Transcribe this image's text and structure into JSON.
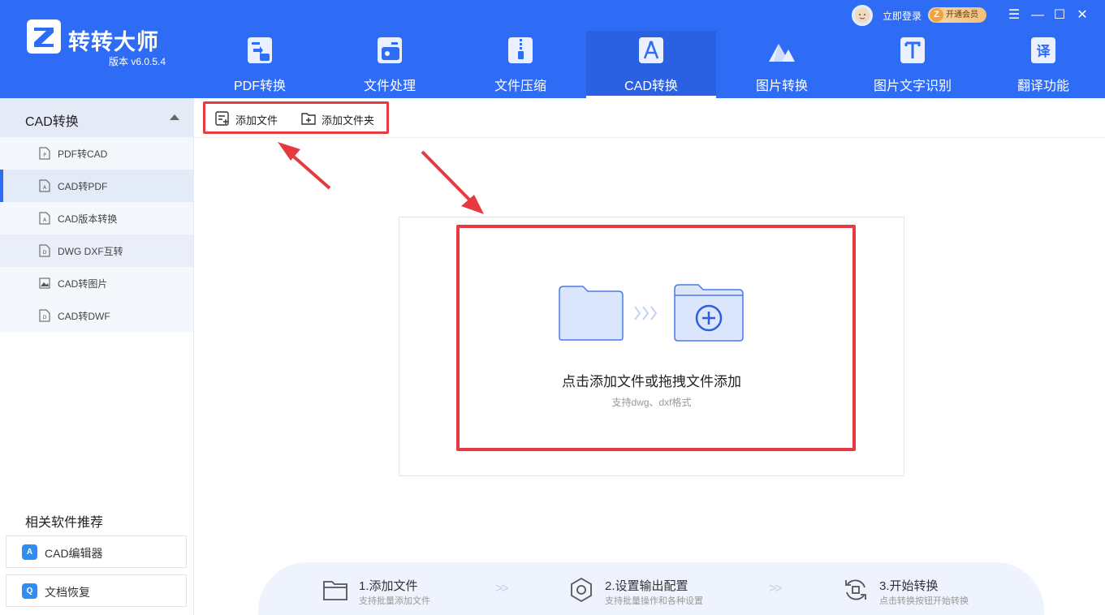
{
  "app": {
    "name": "转转大师",
    "version": "版本 v6.0.5.4",
    "login": "立即登录",
    "vip": "开通会员"
  },
  "nav": [
    {
      "label": "PDF转换",
      "icon": "pdf-convert-icon"
    },
    {
      "label": "文件处理",
      "icon": "file-process-icon"
    },
    {
      "label": "文件压缩",
      "icon": "file-compress-icon"
    },
    {
      "label": "CAD转换",
      "icon": "cad-convert-icon",
      "active": true
    },
    {
      "label": "图片转换",
      "icon": "image-convert-icon"
    },
    {
      "label": "图片文字识别",
      "icon": "ocr-icon"
    },
    {
      "label": "翻译功能",
      "icon": "translate-icon"
    }
  ],
  "window": {
    "menu": "☰",
    "minimize": "—",
    "maximize": "☐",
    "close": "✕"
  },
  "sidebar": {
    "header": "CAD转换",
    "items": [
      {
        "label": "PDF转CAD"
      },
      {
        "label": "CAD转PDF",
        "active": true
      },
      {
        "label": "CAD版本转换"
      },
      {
        "label": "DWG DXF互转"
      },
      {
        "label": "CAD转图片"
      },
      {
        "label": "CAD转DWF"
      }
    ],
    "recommend_title": "相关软件推荐",
    "recommend": [
      {
        "label": "CAD编辑器",
        "icon_text": "A"
      },
      {
        "label": "文档恢复",
        "icon_text": "Q"
      }
    ]
  },
  "toolbar": {
    "add_file": "添加文件",
    "add_folder": "添加文件夹"
  },
  "dropzone": {
    "title": "点击添加文件或拖拽文件添加",
    "subtitle": "支持dwg、dxf格式"
  },
  "steps": [
    {
      "title": "1.添加文件",
      "sub": "支持批量添加文件"
    },
    {
      "title": "2.设置输出配置",
      "sub": "支持批量操作和各种设置"
    },
    {
      "title": "3.开始转换",
      "sub": "点击转换按钮开始转换"
    }
  ],
  "colors": {
    "brand": "#2f6cf6",
    "highlight_red": "#e53a3f"
  }
}
